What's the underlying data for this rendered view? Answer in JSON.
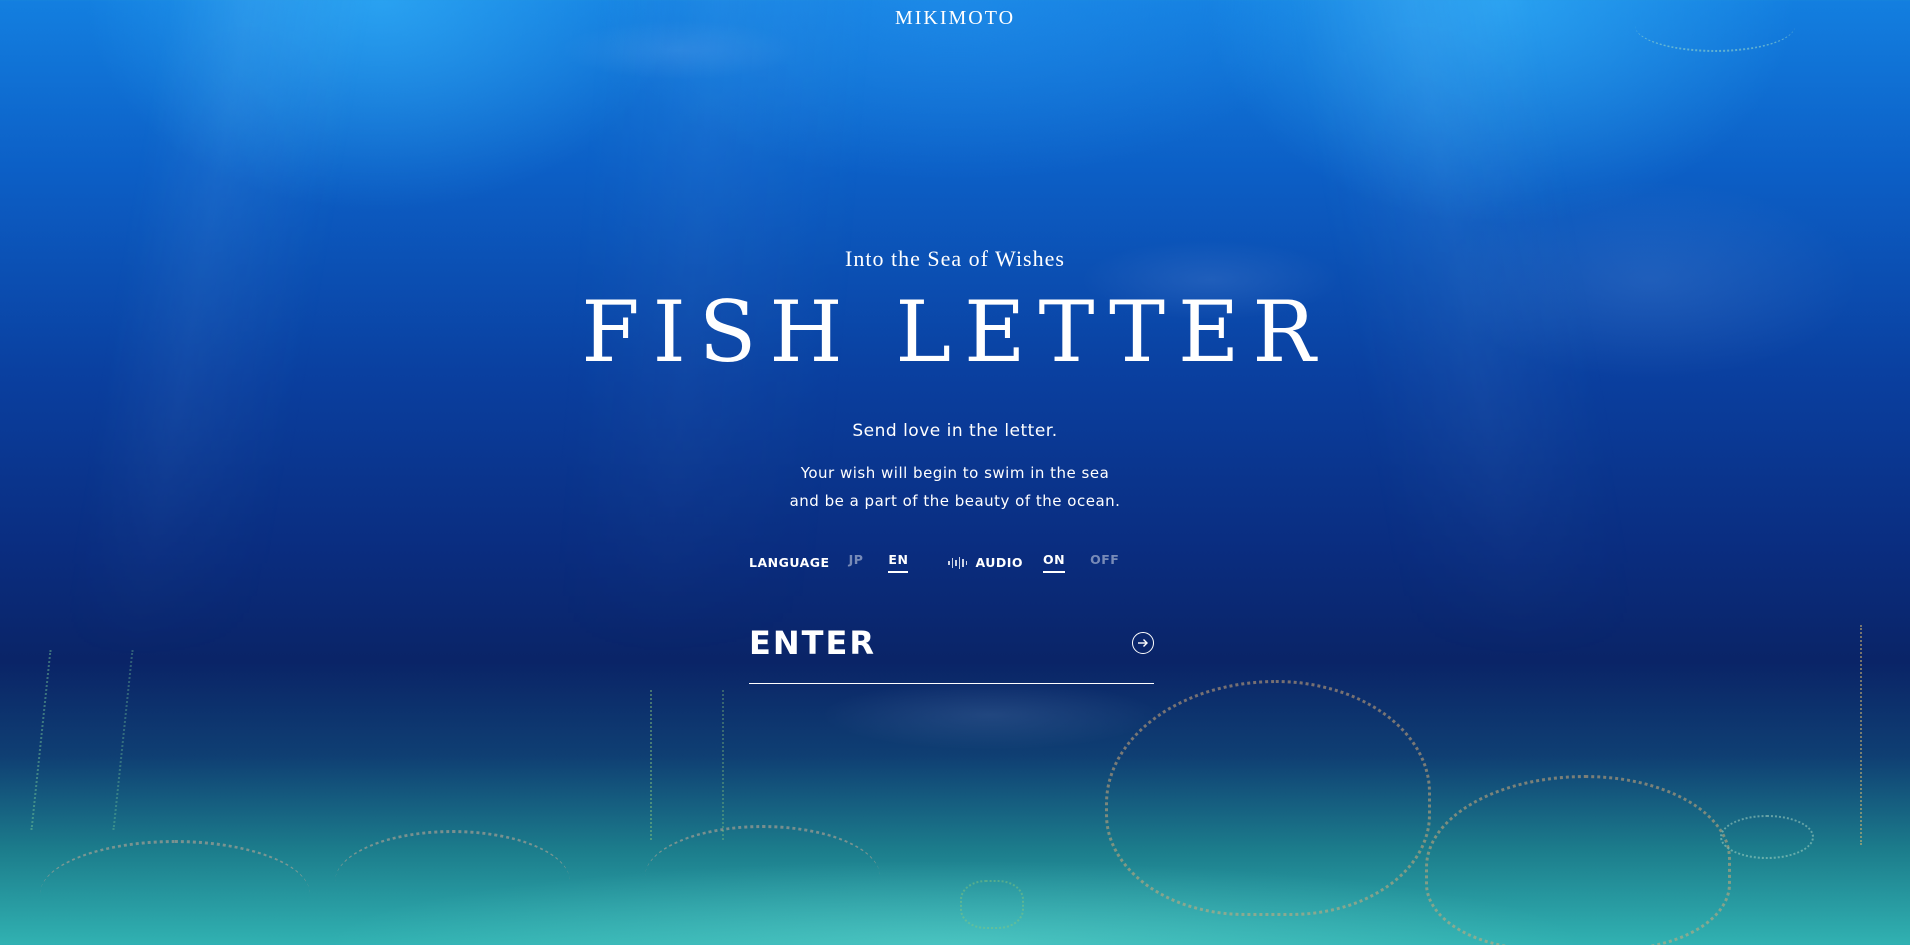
{
  "brand": "MIKIMOTO",
  "subtitle": "Into the Sea of Wishes",
  "title": "FISH LETTER",
  "tagline": "Send love in the letter.",
  "description": [
    "Your wish will begin to swim in the sea",
    "and be a part of the beauty of the ocean."
  ],
  "language": {
    "label": "LANGUAGE",
    "options": [
      "JP",
      "EN"
    ],
    "selected": "EN"
  },
  "audio": {
    "label": "AUDIO",
    "icon": "audio-wave-icon",
    "options": [
      "ON",
      "OFF"
    ],
    "selected": "ON"
  },
  "enter": {
    "label": "ENTER",
    "icon": "arrow-right-circle-icon"
  },
  "colors": {
    "deep_blue": "#0a2d80",
    "surface_blue": "#137fe0",
    "seabed_teal": "#31b2b2",
    "text": "#ffffff",
    "inactive_text": "rgba(255,255,255,0.45)",
    "letter_gold": "#c89a6a",
    "letter_green": "#7fae8a"
  }
}
